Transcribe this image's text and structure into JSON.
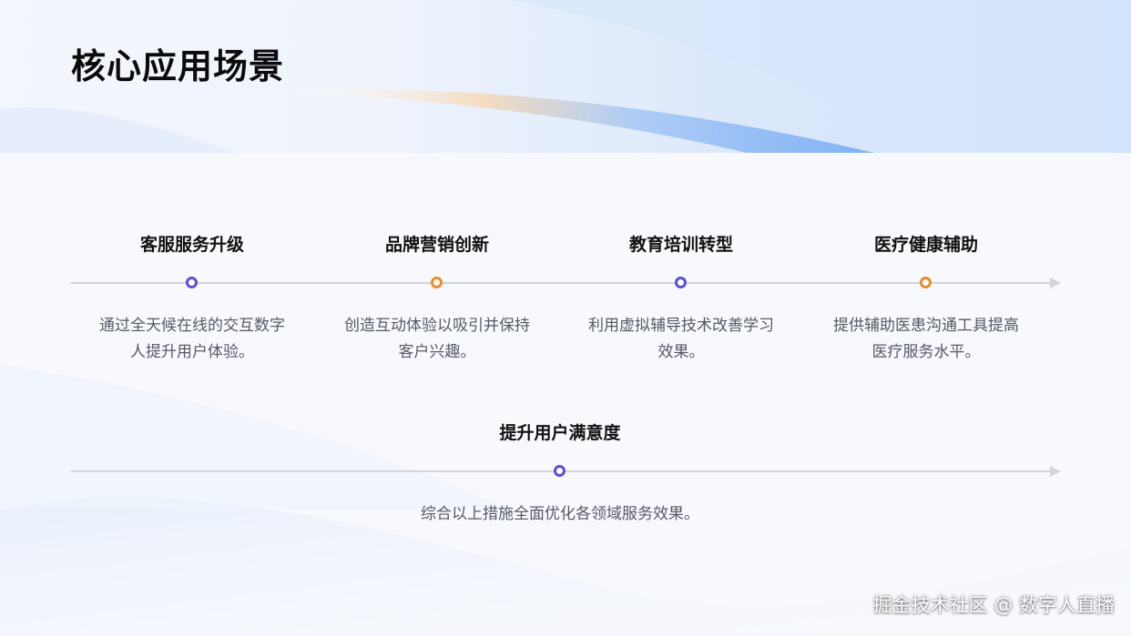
{
  "slide": {
    "title": "核心应用场景"
  },
  "timeline_1": {
    "items": [
      {
        "title": "客服服务升级",
        "desc": "通过全天候在线的交互数字人提升用户体验。",
        "dot_color": "#5b4fd6"
      },
      {
        "title": "品牌营销创新",
        "desc": "创造互动体验以吸引并保持客户兴趣。",
        "dot_color": "#ee8a2a"
      },
      {
        "title": "教育培训转型",
        "desc": "利用虚拟辅导技术改善学习效果。",
        "dot_color": "#5b4fd6"
      },
      {
        "title": "医疗健康辅助",
        "desc": "提供辅助医患沟通工具提高医疗服务水平。",
        "dot_color": "#ee8a2a"
      }
    ]
  },
  "timeline_2": {
    "items": [
      {
        "title": "提升用户满意度",
        "desc": "综合以上措施全面优化各领域服务效果。",
        "dot_color": "#5b4fd6"
      }
    ]
  },
  "watermark": {
    "text": "掘金技术社区 @ 数字人直播"
  },
  "colors": {
    "accent_purple": "#5b4fd6",
    "accent_orange": "#ee8a2a",
    "title_text": "#0b0b0b",
    "body_text": "#555a63",
    "line": "#d3d5da"
  }
}
